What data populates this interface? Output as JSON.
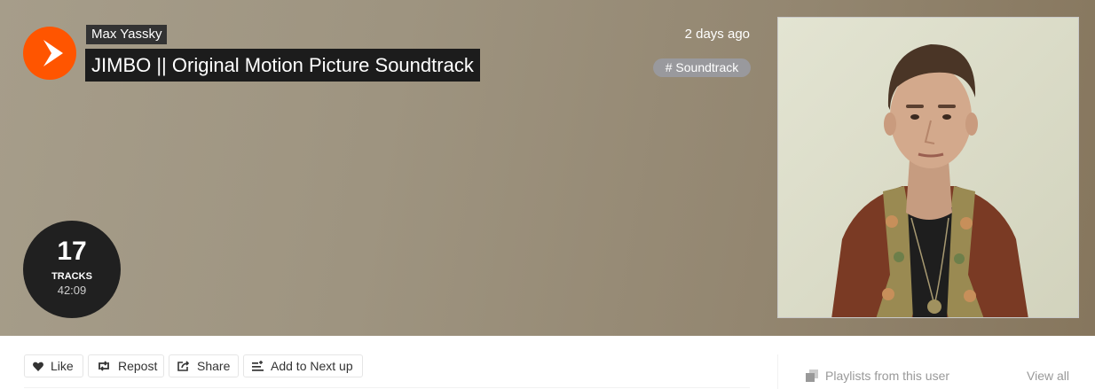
{
  "header": {
    "artist": "Max Yassky",
    "title": "JIMBO || Original Motion Picture Soundtrack",
    "posted": "2 days ago",
    "tag": "# Soundtrack"
  },
  "tracks": {
    "count": "17",
    "label": "TRACKS",
    "duration": "42:09"
  },
  "actions": {
    "like": "Like",
    "repost": "Repost",
    "share": "Share",
    "add_next": "Add to Next up"
  },
  "sidebar": {
    "playlists_label": "Playlists from this user",
    "view_all": "View all"
  },
  "colors": {
    "accent": "#ff5500",
    "hero_gradient_start": "#a69d8a",
    "hero_gradient_end": "#86765d"
  },
  "icons": [
    "play-icon",
    "heart-icon",
    "repost-icon",
    "share-icon",
    "add-to-queue-icon",
    "playlist-stack-icon"
  ]
}
